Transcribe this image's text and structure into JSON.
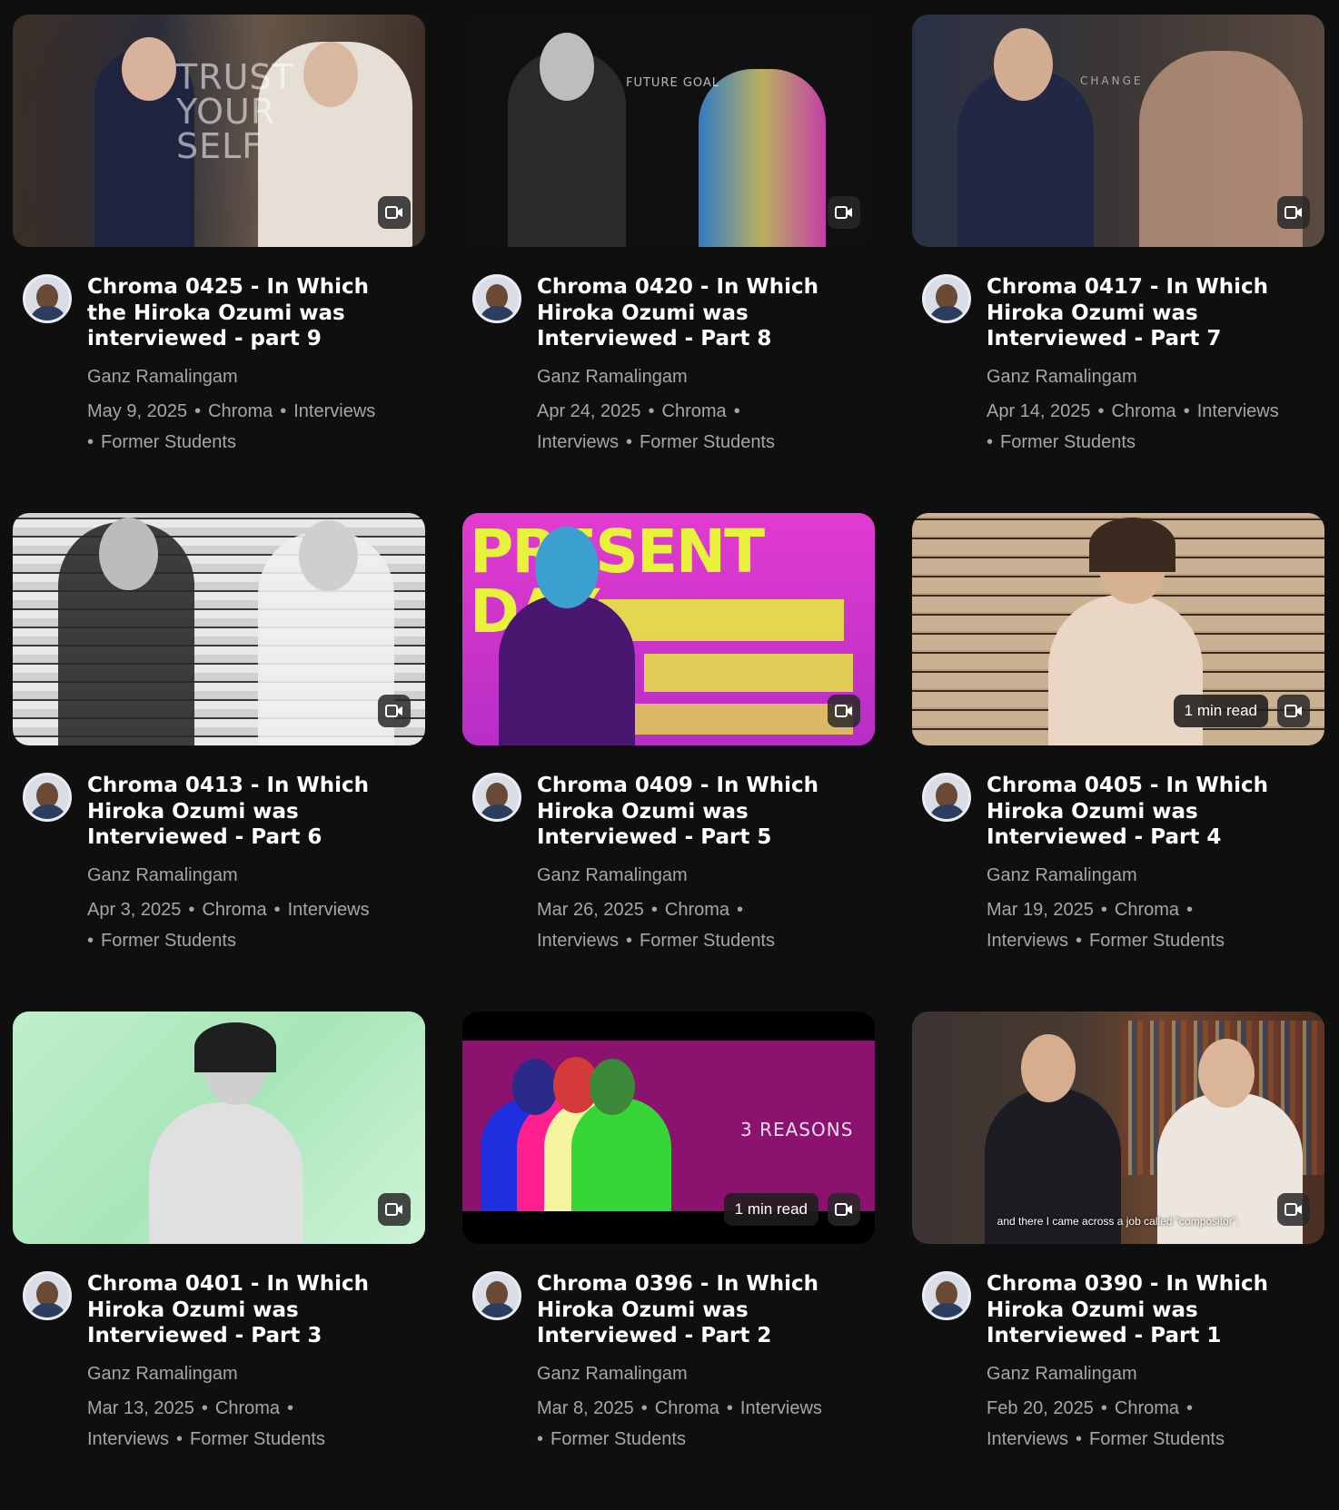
{
  "author": "Ganz Ramalingam",
  "read_time_label": "1 min read",
  "colors": {
    "background": "#0f0f10",
    "title": "#ffffff",
    "meta": "#a6a6a6"
  },
  "icons": {
    "media": "video-camera-icon"
  },
  "posts": [
    {
      "title": "Chroma 0425 - In Which the Hiroka Ozumi was interviewed - part 9",
      "date": "May 9, 2025",
      "category": "Chroma",
      "tags": [
        "Interviews",
        "Former Students"
      ],
      "overlay": "TRUST YOUR SELF"
    },
    {
      "title": "Chroma 0420 - In Which Hiroka Ozumi was Interviewed - Part 8",
      "date": "Apr 24, 2025",
      "category": "Chroma",
      "tags": [
        "Interviews",
        "Former Students"
      ],
      "overlay": "FUTURE GOAL"
    },
    {
      "title": "Chroma 0417 - In Which Hiroka Ozumi was Interviewed - Part 7",
      "date": "Apr 14, 2025",
      "category": "Chroma",
      "tags": [
        "Interviews",
        "Former Students"
      ],
      "overlay": "CHANGE"
    },
    {
      "title": "Chroma 0413 - In Which Hiroka Ozumi was Interviewed - Part 6",
      "date": "Apr 3, 2025",
      "category": "Chroma",
      "tags": [
        "Interviews",
        "Former Students"
      ],
      "overlay": ""
    },
    {
      "title": "Chroma 0409 - In Which Hiroka Ozumi was Interviewed - Part 5",
      "date": "Mar 26, 2025",
      "category": "Chroma",
      "tags": [
        "Interviews",
        "Former Students"
      ],
      "overlay": "PRESENT DAY"
    },
    {
      "title": "Chroma 0405 - In Which Hiroka Ozumi was Interviewed - Part 4",
      "date": "Mar 19, 2025",
      "category": "Chroma",
      "tags": [
        "Interviews",
        "Former Students"
      ],
      "overlay": "",
      "read_time": true
    },
    {
      "title": "Chroma 0401 - In Which Hiroka Ozumi was Interviewed - Part 3",
      "date": "Mar 13, 2025",
      "category": "Chroma",
      "tags": [
        "Interviews",
        "Former Students"
      ],
      "overlay": ""
    },
    {
      "title": "Chroma 0396 - In Which Hiroka Ozumi was Interviewed - Part 2",
      "date": "Mar 8, 2025",
      "category": "Chroma",
      "tags": [
        "Interviews",
        "Former Students"
      ],
      "overlay": "3 REASONS",
      "read_time": true
    },
    {
      "title": "Chroma 0390 - In Which Hiroka Ozumi was Interviewed - Part 1",
      "date": "Feb 20, 2025",
      "category": "Chroma",
      "tags": [
        "Interviews",
        "Former Students"
      ],
      "overlay": "",
      "subtitle": "and there I came across a job called \"compositor\"."
    }
  ]
}
